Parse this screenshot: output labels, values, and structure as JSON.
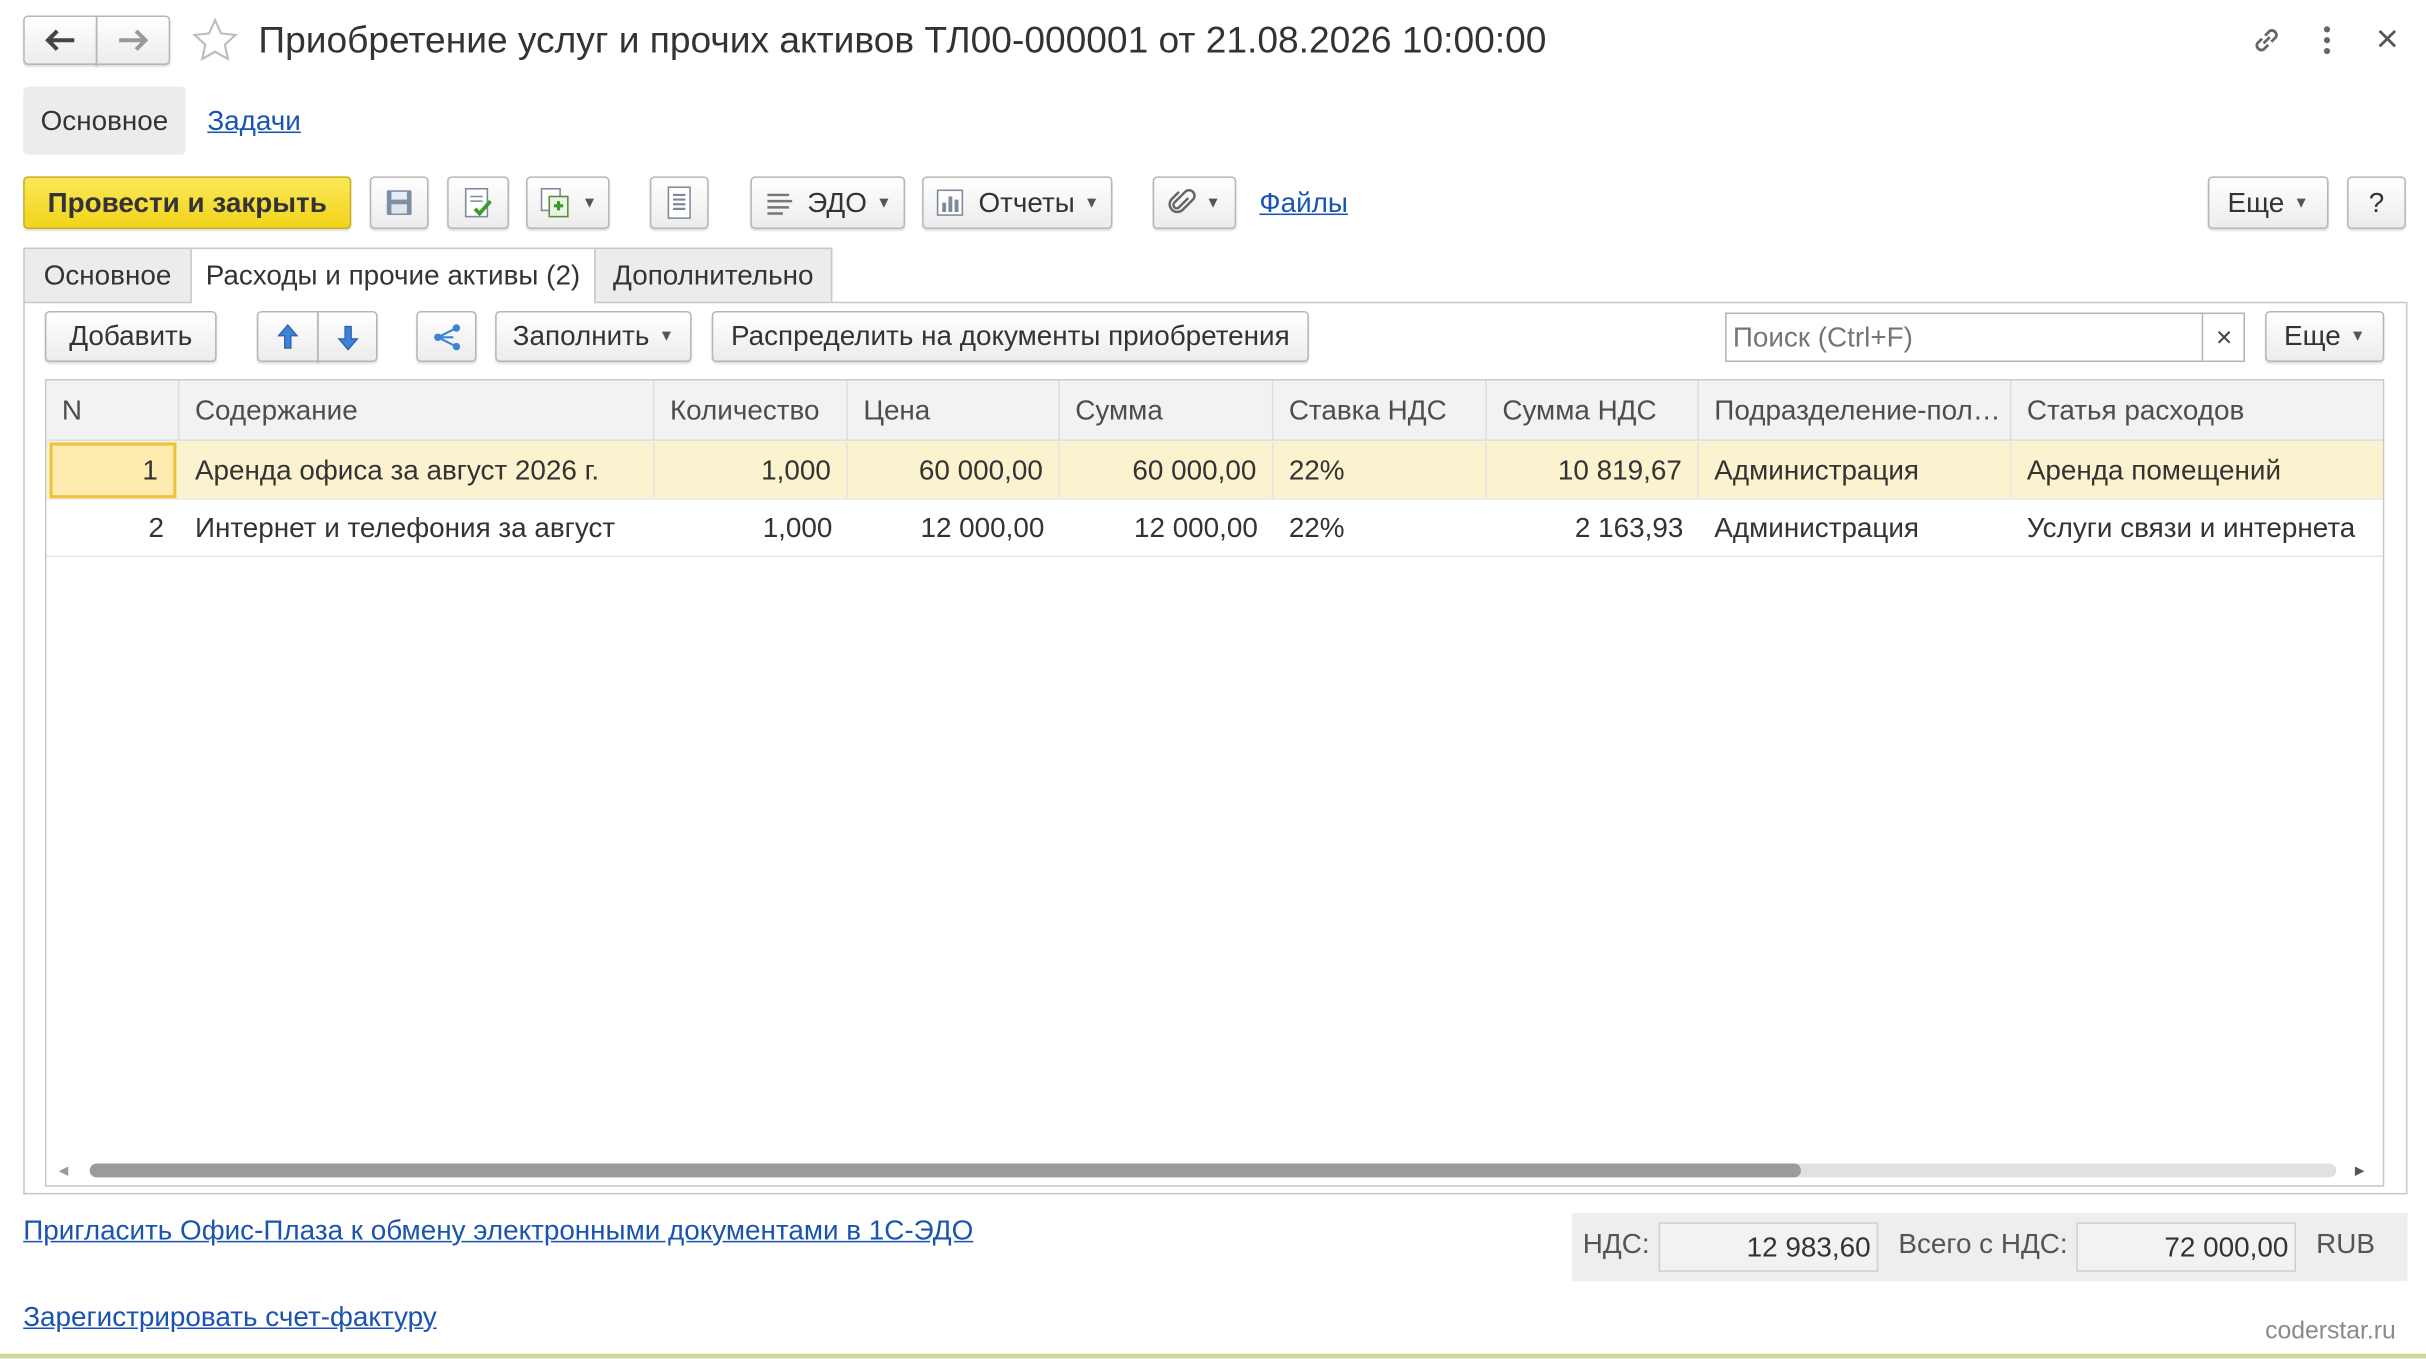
{
  "window": {
    "title": "Приобретение услуг и прочих активов ТЛ00-000001 от 21.08.2026 10:00:00",
    "nav_back_icon": "arrow-left-icon",
    "nav_forward_icon": "arrow-right-icon",
    "favorite_icon": "star-icon"
  },
  "panel_tabs": {
    "main": "Основное",
    "tasks": "Задачи"
  },
  "toolbar": {
    "post_close": "Провести и закрыть",
    "edo": "ЭДО",
    "reports": "Отчеты",
    "files": "Файлы",
    "more": "Еще",
    "help": "?"
  },
  "tabs": [
    "Основное",
    "Расходы и прочие активы (2)",
    "Дополнительно"
  ],
  "table_toolbar": {
    "add": "Добавить",
    "fill": "Заполнить",
    "distribute": "Распределить на документы приобретения",
    "search_placeholder": "Поиск (Ctrl+F)",
    "search_clear": "×",
    "more": "Еще"
  },
  "table": {
    "columns": [
      "N",
      "Содержание",
      "Количество",
      "Цена",
      "Сумма",
      "Ставка НДС",
      "Сумма НДС",
      "Подразделение-пол…",
      "Статья расходов"
    ],
    "rows": [
      [
        "1",
        "Аренда офиса за август 2026 г.",
        "1,000",
        "60 000,00",
        "60 000,00",
        "22%",
        "10 819,67",
        "Администрация",
        "Аренда помещений"
      ],
      [
        "2",
        "Интернет и телефония за август",
        "1,000",
        "12 000,00",
        "12 000,00",
        "22%",
        "2 163,93",
        "Администрация",
        "Услуги связи и интернета"
      ]
    ],
    "selected_row": 1
  },
  "totals": {
    "vat_label": "НДС:",
    "vat_value": "12 983,60",
    "total_label": "Всего с НДС:",
    "total_value": "72 000,00",
    "currency": "RUB"
  },
  "links": {
    "invite": "Пригласить Офис-Плаза к обмену электронными документами в 1С-ЭДО",
    "register_invoice": "Зарегистрировать счет-фактуру"
  },
  "watermark": "coderstar.ru",
  "colors": {
    "primary_button": "#f5dc2a",
    "selected_row": "#fbf2cf",
    "link": "#1a54b0"
  }
}
